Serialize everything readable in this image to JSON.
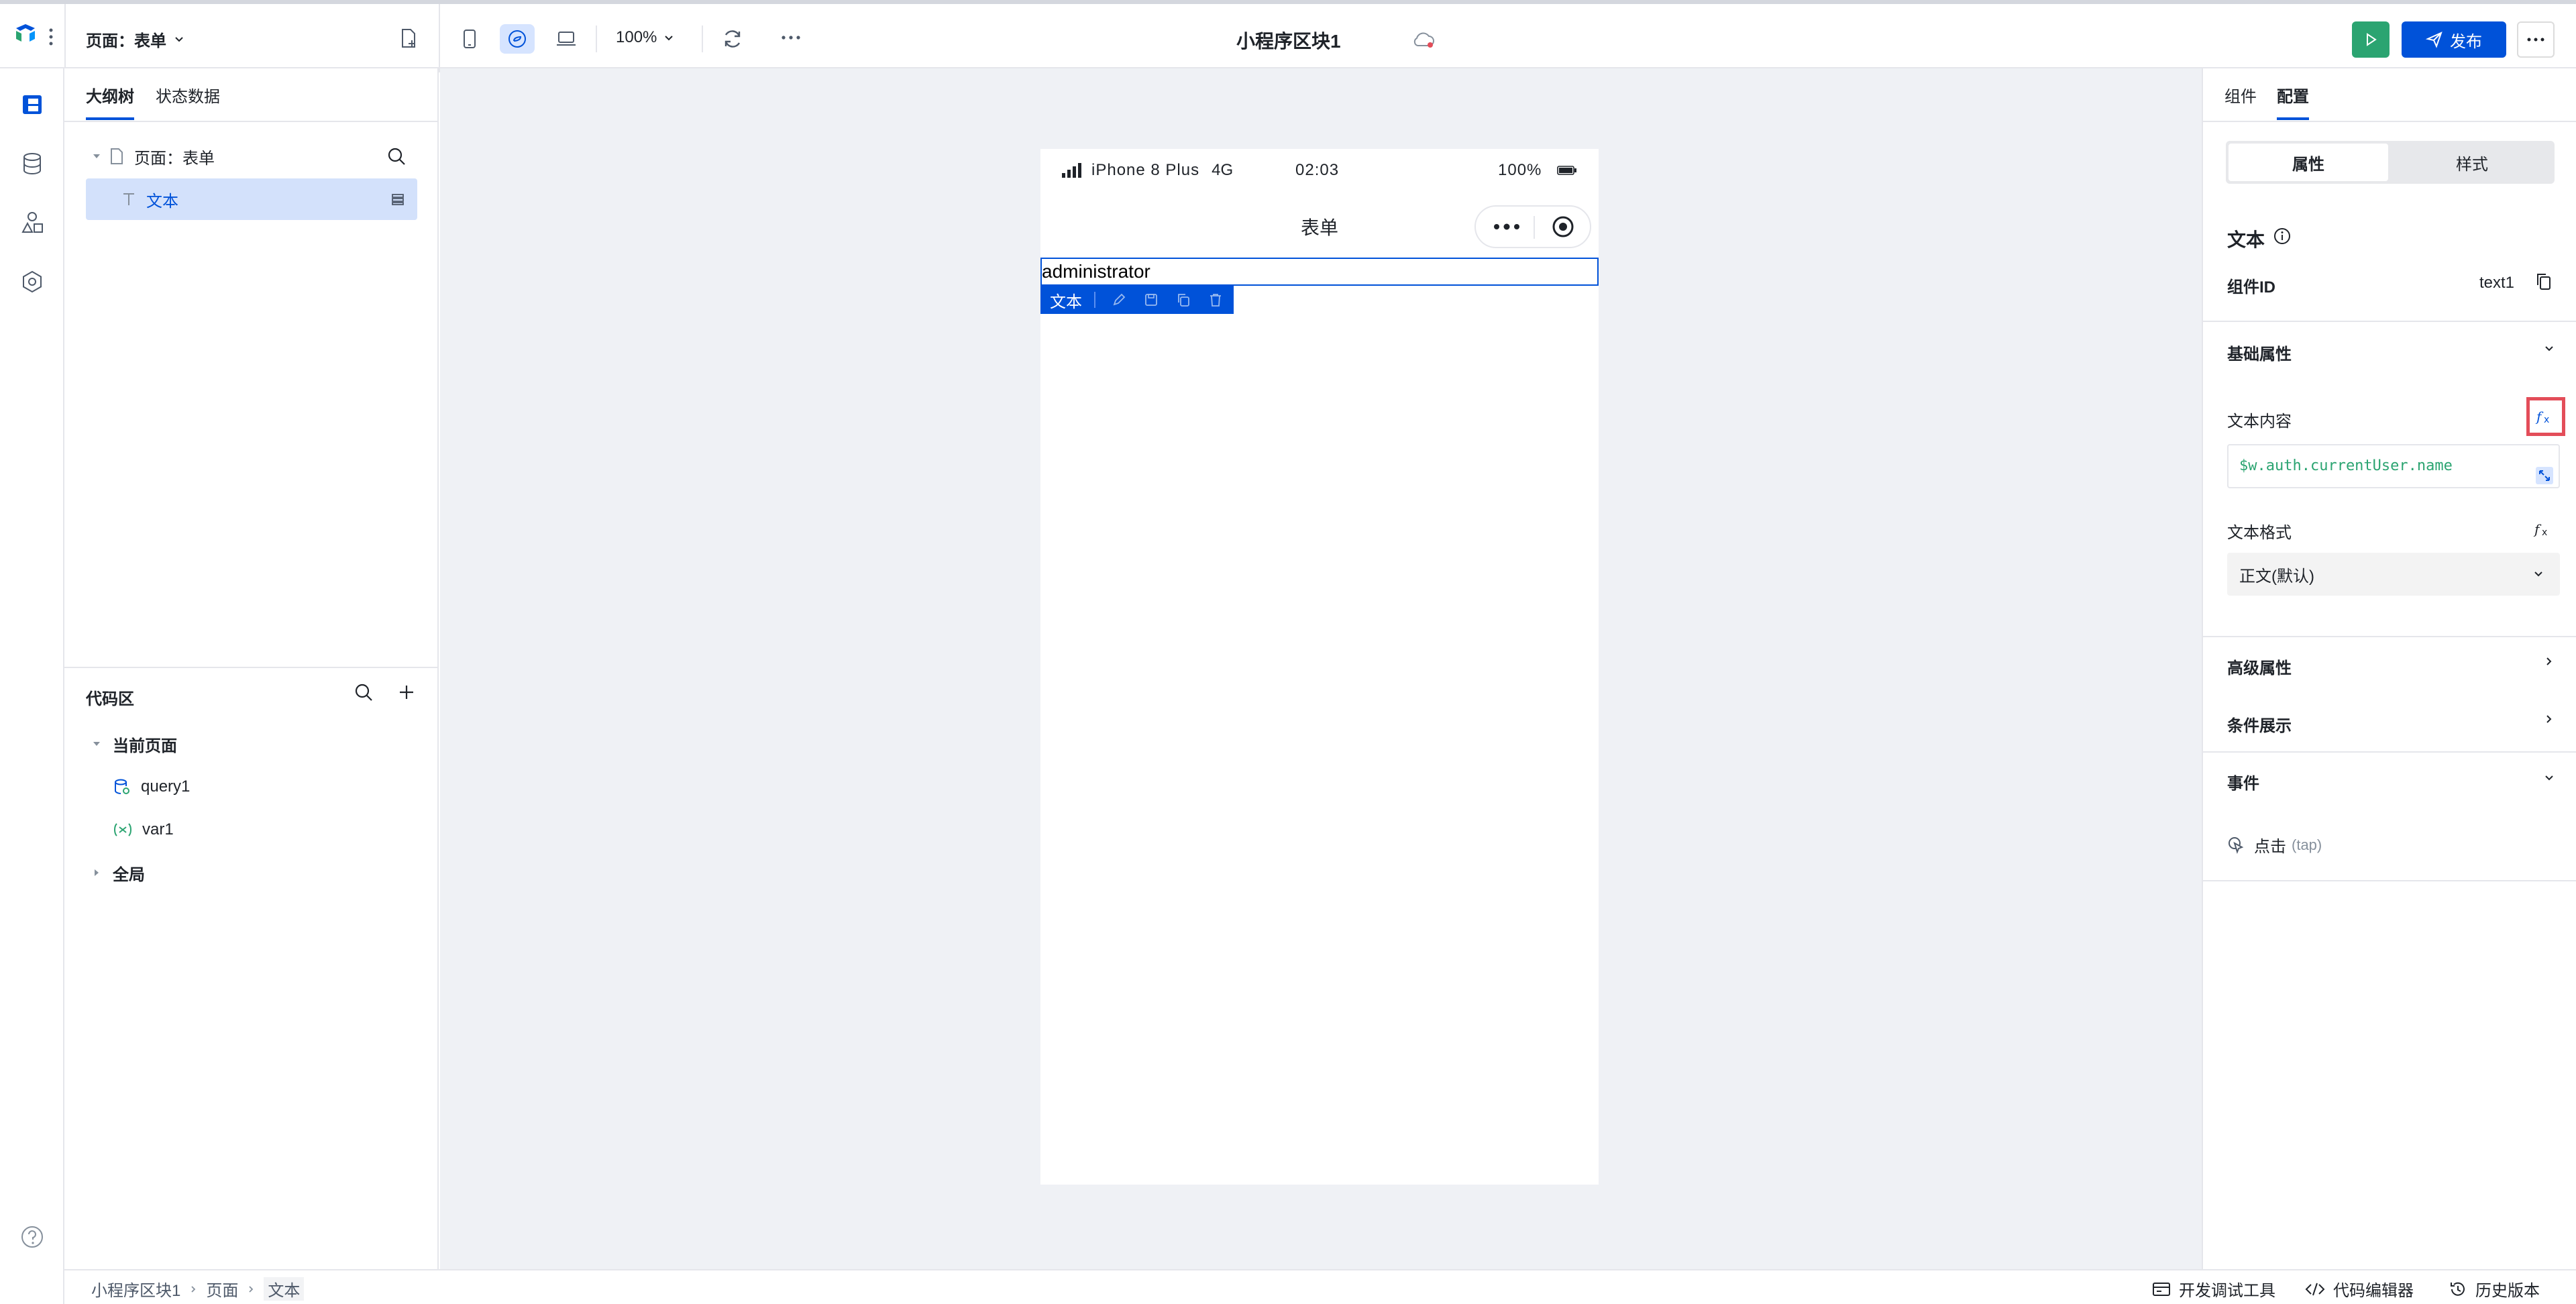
{
  "topbar": {
    "page_selector": "页面：表单",
    "zoom": "100%",
    "title": "小程序区块1",
    "publish": "发布"
  },
  "outline": {
    "tabs": [
      "大纲树",
      "状态数据"
    ],
    "tree": {
      "page": "页面：表单",
      "text": "文本"
    },
    "code_area": {
      "title": "代码区",
      "current_page": "当前页面",
      "items": [
        "query1",
        "var1"
      ],
      "global": "全局"
    }
  },
  "phone": {
    "status": {
      "device": "iPhone 8 Plus",
      "network": "4G",
      "time": "02:03",
      "battery": "100%"
    },
    "nav_title": "表单",
    "selected_text": "administrator",
    "toolbar_label": "文本"
  },
  "config": {
    "tabs": [
      "组件",
      "配置"
    ],
    "segments": [
      "属性",
      "样式"
    ],
    "component_name": "文本",
    "component_id_label": "组件ID",
    "component_id": "text1",
    "basic_props": "基础属性",
    "text_content_label": "文本内容",
    "text_content_value": "$w.auth.currentUser.name",
    "text_format_label": "文本格式",
    "text_format_value": "正文(默认)",
    "advanced_props": "高级属性",
    "conditional": "条件展示",
    "events": "事件",
    "event_tap": "点击",
    "event_tap_hint": "(tap)"
  },
  "bottombar": {
    "breadcrumb": [
      "小程序区块1",
      "页面",
      "文本"
    ],
    "tools": [
      "开发调试工具",
      "代码编辑器",
      "历史版本"
    ]
  },
  "colors": {
    "primary": "#0052d9",
    "run_green": "#2ba471",
    "highlight_red": "#e34d59",
    "code_green": "#2ba471"
  }
}
